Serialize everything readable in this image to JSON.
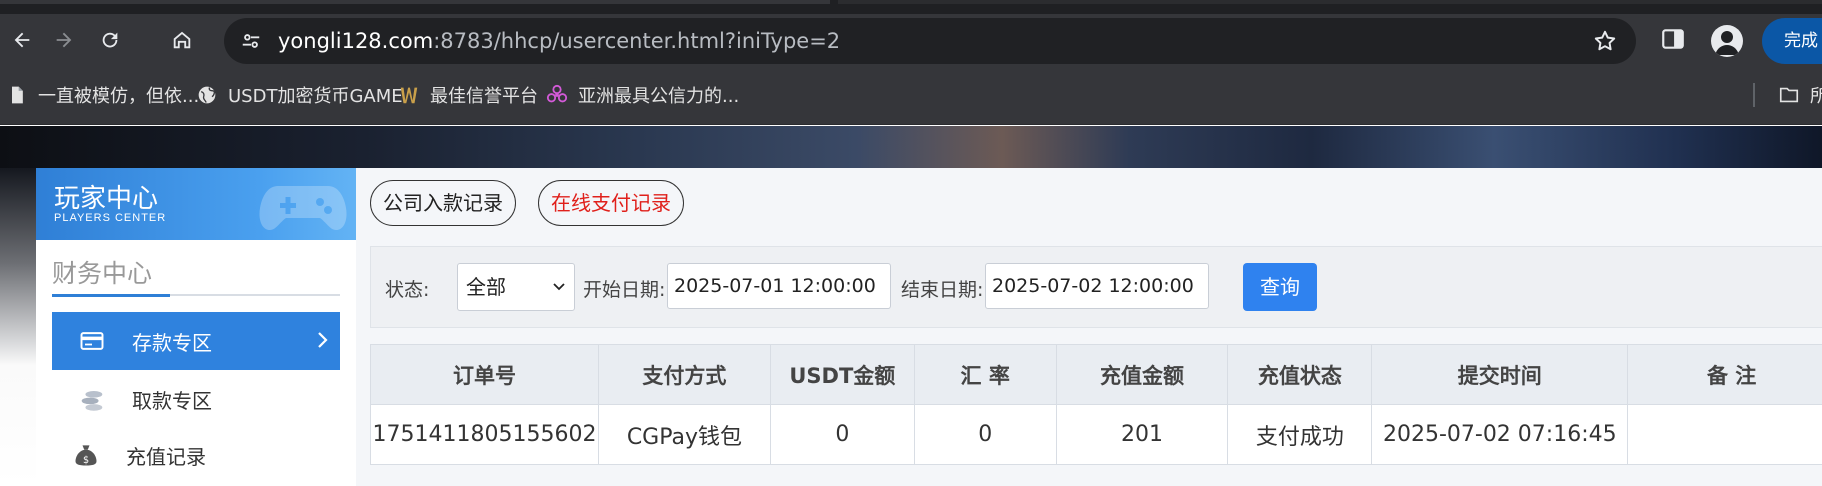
{
  "browser": {
    "address": {
      "host": "yongli128.com",
      "path": ":8783/hhcp/usercenter.html?iniType=2"
    },
    "finish_button_label": "完成",
    "bookmarks": [
      {
        "label": "一直被模仿，但依...",
        "icon": "document-icon"
      },
      {
        "label": "USDT加密货币GAME",
        "icon": "globe-icon"
      },
      {
        "label": "最佳信誉平台",
        "icon": "brand-icon"
      },
      {
        "label": "亚洲最具公信力的...",
        "icon": "flower-icon"
      }
    ],
    "bookmarks_folder_label": "所"
  },
  "sidebar": {
    "header_title": "玩家中心",
    "header_subtitle": "PLAYERS CENTER",
    "section_title": "财务中心",
    "items": [
      {
        "label": "存款专区",
        "icon": "card-icon",
        "active": true
      },
      {
        "label": "取款专区",
        "icon": "coins-icon",
        "active": false
      },
      {
        "label": "充值记录",
        "icon": "money-bag-icon",
        "active": false
      }
    ]
  },
  "content": {
    "tabs": [
      {
        "label": "公司入款记录"
      },
      {
        "label": "在线支付记录"
      }
    ],
    "filter": {
      "status_label": "状态:",
      "status_value": "全部",
      "start_label": "开始日期:",
      "start_value": "2025-07-01 12:00:00",
      "end_label": "结束日期:",
      "end_value": "2025-07-02 12:00:00",
      "query_label": "查询"
    },
    "table": {
      "headers": [
        "订单号",
        "支付方式",
        "USDT金额",
        "汇 率",
        "充值金额",
        "充值状态",
        "提交时间",
        "备 注"
      ],
      "rows": [
        [
          "1751411805155602",
          "CGPay钱包",
          "0",
          "0",
          "201",
          "支付成功",
          "2025-07-02 07:16:45",
          ""
        ]
      ]
    }
  },
  "colors": {
    "accent": "#2f82de",
    "tab_active_text": "#e0201b",
    "chrome_bg": "#35363a"
  }
}
